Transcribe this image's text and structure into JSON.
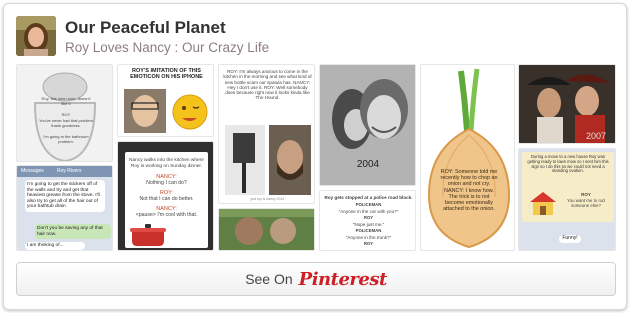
{
  "board": {
    "title": "Our Peaceful Planet",
    "pinner_line": "Roy Loves Nancy : Our Crazy Life"
  },
  "pins": {
    "toilet": {
      "text_top": "Roy, this new room, doesn't like it",
      "label_roy": "ROY",
      "text_mid": "You've never had that problem thank goodness.",
      "text_bottom": "I'm going to the bathroom problem."
    },
    "imitation": {
      "caption": "ROY'S IMITATION OF THIS EMOTICON ON HIS IPHONE"
    },
    "kitchen_roy": {
      "text": "ROY: I'm always anxious to come in the kitchen in the morning and see what kind of new bottle scam our spatula has. NANCY: Hey I don't use it. ROY: Well somebody does because right now it looks kinda like The Hound.",
      "footer": "just roy & nancy 2014"
    },
    "couple": {
      "year": "2004"
    },
    "onion": {
      "text": "ROY: Someone told me recently how to chop an onion and not cry. NANCY: I know how. The trick is to not become emotionally attached to the onion."
    },
    "pirates": {
      "year": "2007"
    },
    "texts": {
      "header": "Messages",
      "contact": "Roy Rivers",
      "bubble1": "I'm going to get the stickers off of the walls and try and get that heaviest grease from the stove. I'll also try to get all of the hair out of your bathtub drain",
      "bubble2": "Don't you be saving any of that hair now.",
      "bubble3": "I am thinking of..."
    },
    "kitchen_nancy": {
      "intro": "Nancy walks into the kitchen where Roy is working on Sunday dinner.",
      "nancy1_label": "NANCY:",
      "nancy1": "Nothing I can do?",
      "roy1_label": "ROY:",
      "roy1": "Not that I can do better.",
      "nancy2_label": "NANCY:",
      "nancy2": "<pause> I'm cool with that."
    },
    "police": {
      "line1": "Roy gets stopped at a police road block.",
      "label1": "POLICEMAN",
      "line2": "\"Anyone in the car with you?\"",
      "label2": "ROY",
      "line3": "\"Nope just me.\"",
      "label3": "POLICEMAN",
      "line4": "\"Anyone in the trunk?\"",
      "label4": "ROY"
    },
    "tinyhouse": {
      "text": "During a move to a new house Roy was getting ready to lawn mow so I sent him this sign so I do this so we could not need a standing ovation.",
      "label_roy": "ROY",
      "answer": "You want me to rod someone else?",
      "reply": "Funny!"
    }
  },
  "see_on": {
    "label": "See On",
    "brand": "Pinterest"
  },
  "colors": {
    "brand_red": "#cb2027",
    "title_text": "#333333",
    "subtitle_text": "#8c7e7e"
  }
}
